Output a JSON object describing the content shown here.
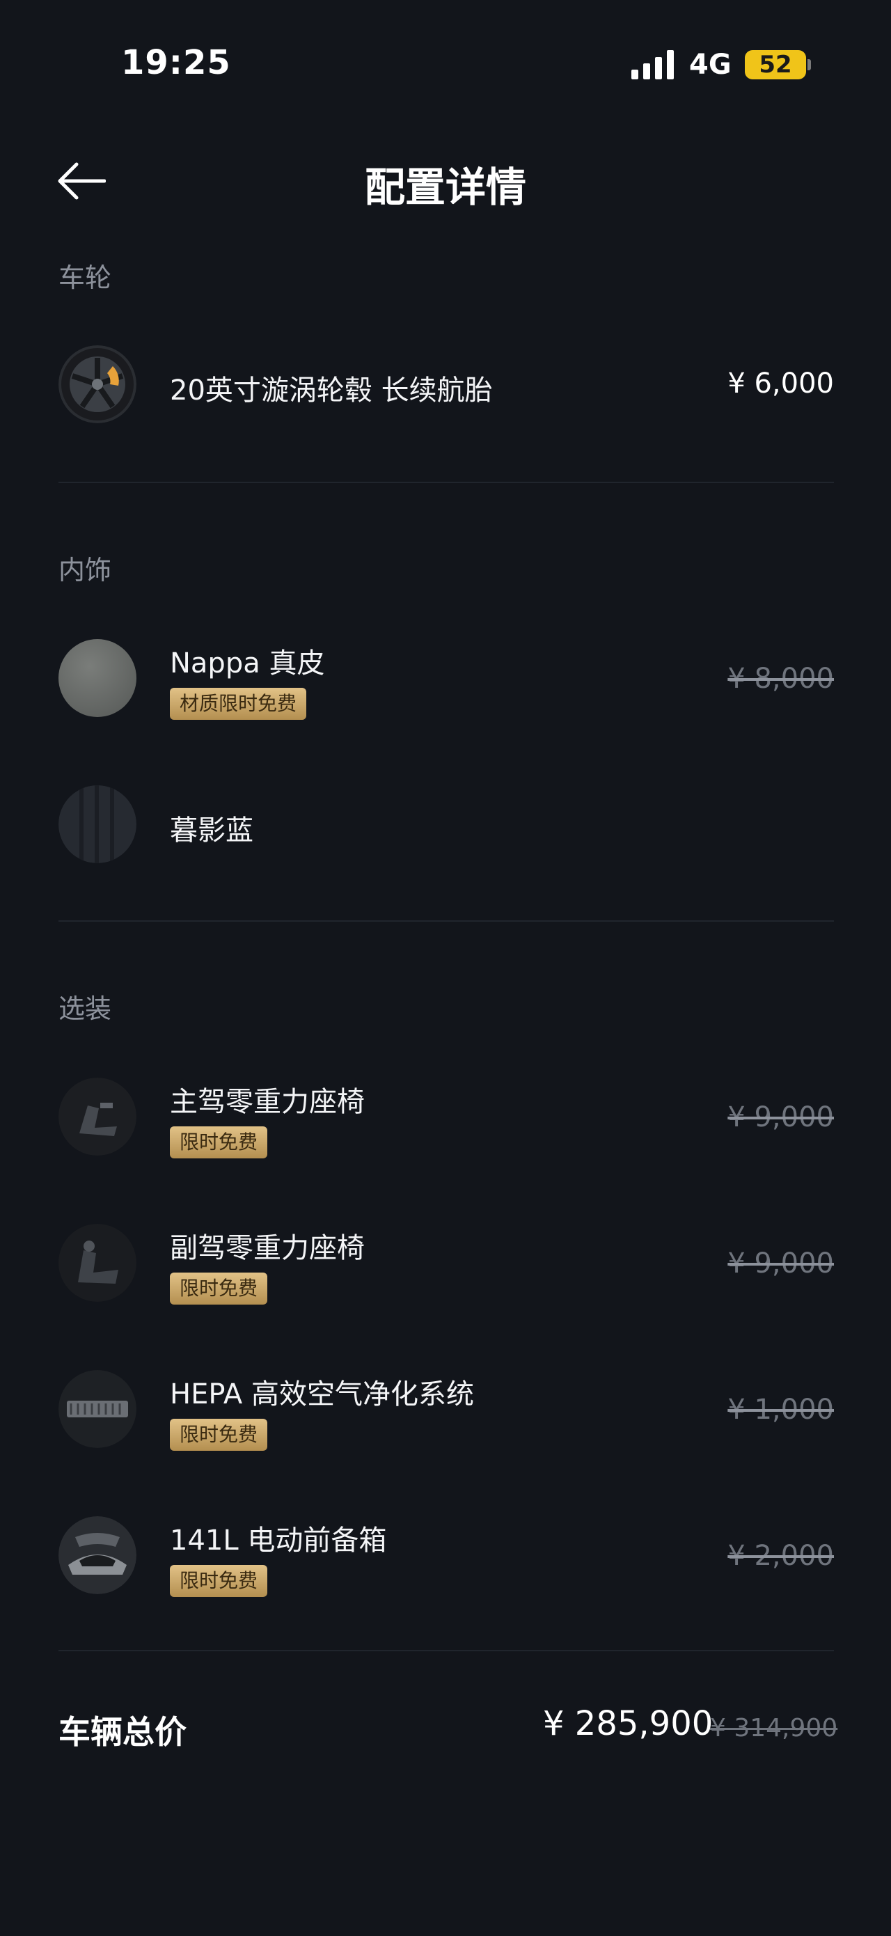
{
  "status_bar": {
    "time": "19:25",
    "network": "4G",
    "battery": "52"
  },
  "header": {
    "title": "配置详情"
  },
  "sections": {
    "wheels": {
      "label": "车轮",
      "items": [
        {
          "name": "20英寸漩涡轮毂 长续航胎",
          "price": "¥ 6,000"
        }
      ]
    },
    "interior": {
      "label": "内饰",
      "items": [
        {
          "name": "Nappa 真皮",
          "price": "¥ 8,000",
          "badge": "材质限时免费"
        },
        {
          "name": "暮影蓝"
        }
      ]
    },
    "options": {
      "label": "选装",
      "items": [
        {
          "name": "主驾零重力座椅",
          "price": "¥ 9,000",
          "badge": "限时免费"
        },
        {
          "name": "副驾零重力座椅",
          "price": "¥ 9,000",
          "badge": "限时免费"
        },
        {
          "name": "HEPA 高效空气净化系统",
          "price": "¥ 1,000",
          "badge": "限时免费"
        },
        {
          "name": "141L 电动前备箱",
          "price": "¥ 2,000",
          "badge": "限时免费"
        }
      ]
    }
  },
  "total": {
    "label": "车辆总价",
    "price": "¥ 285,900",
    "original_price": "¥ 314,900"
  },
  "colors": {
    "background": "#12151b",
    "badge_gold": "#c9a56b",
    "battery": "#f0c419"
  }
}
